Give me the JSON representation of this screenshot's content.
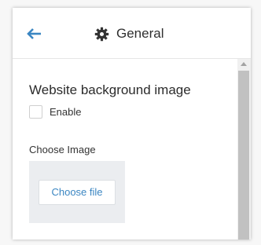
{
  "header": {
    "title": "General",
    "back_icon": "arrow-left-icon",
    "title_icon": "gear-icon"
  },
  "section": {
    "title": "Website background image",
    "enable_label": "Enable",
    "enable_checked": false,
    "choose_image_label": "Choose Image",
    "choose_file_button": "Choose file"
  },
  "colors": {
    "accent": "#3b86c2",
    "text": "#2f2f2f",
    "image_box_bg": "#ebedf0"
  }
}
